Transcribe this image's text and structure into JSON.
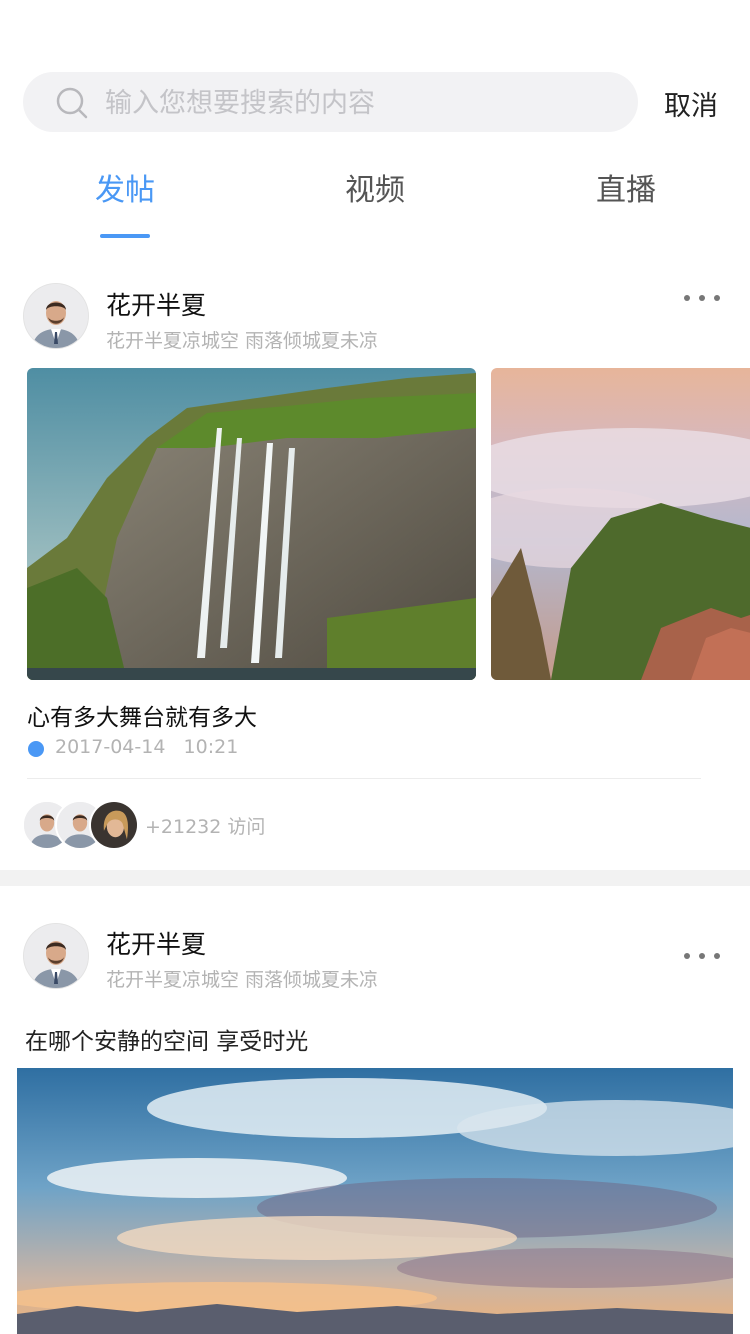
{
  "search": {
    "placeholder": "输入您想要搜索的内容",
    "cancel_label": "取消"
  },
  "tabs": [
    {
      "label": "发帖",
      "active": true
    },
    {
      "label": "视频",
      "active": false
    },
    {
      "label": "直播",
      "active": false
    }
  ],
  "posts": [
    {
      "author": "花开半夏",
      "subtitle": "花开半夏凉城空 雨落倾城夏未凉",
      "title": "心有多大舞台就有多大",
      "date": "2017-04-14",
      "time": "10:21",
      "visits": "+21232 访问",
      "images": [
        "waterfall-cliff",
        "sea-of-clouds-mountain"
      ]
    },
    {
      "author": "花开半夏",
      "subtitle": "花开半夏凉城空 雨落倾城夏未凉",
      "text": "在哪个安静的空间 享受时光",
      "images": [
        "sunset-sky"
      ]
    }
  ],
  "colors": {
    "accent": "#4a98f5",
    "secondary_text": "#b3b3b3",
    "background": "#f2f2f2"
  }
}
